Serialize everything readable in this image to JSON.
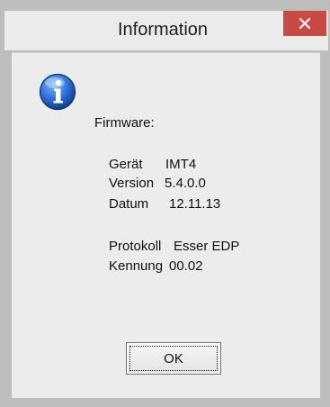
{
  "window": {
    "title": "Information",
    "close_icon": "close-icon"
  },
  "icon": "info-icon",
  "content": {
    "heading": "Firmware:",
    "device_label": "Gerät",
    "device_value": "IMT4",
    "version_label": "Version",
    "version_value": "5.4.0.0",
    "date_label": "Datum",
    "date_value": "12.11.13",
    "protocol_label": "Protokoll",
    "protocol_value": "Esser EDP",
    "id_label": "Kennung",
    "id_value": "00.02"
  },
  "buttons": {
    "ok_label": "OK"
  },
  "colors": {
    "close_button": "#c94a44",
    "dialog_background": "#ececec",
    "icon_blue": "#2a6fd6"
  }
}
